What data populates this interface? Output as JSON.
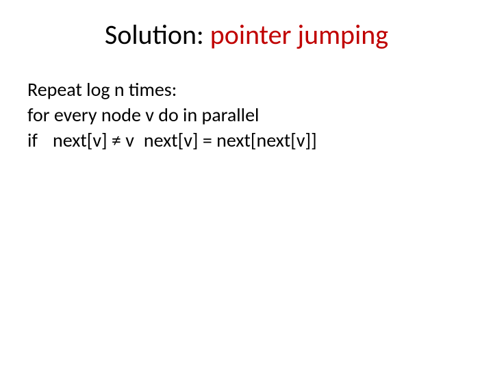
{
  "title": {
    "part1": "Solution: ",
    "part2": "pointer jumping"
  },
  "body": {
    "line1": "Repeat log n times:",
    "line2": "for every node v do in parallel",
    "line3_if": "if",
    "line3_cond": "next[v] ≠ v",
    "line3_assign": "next[v] = next[next[v]]"
  }
}
